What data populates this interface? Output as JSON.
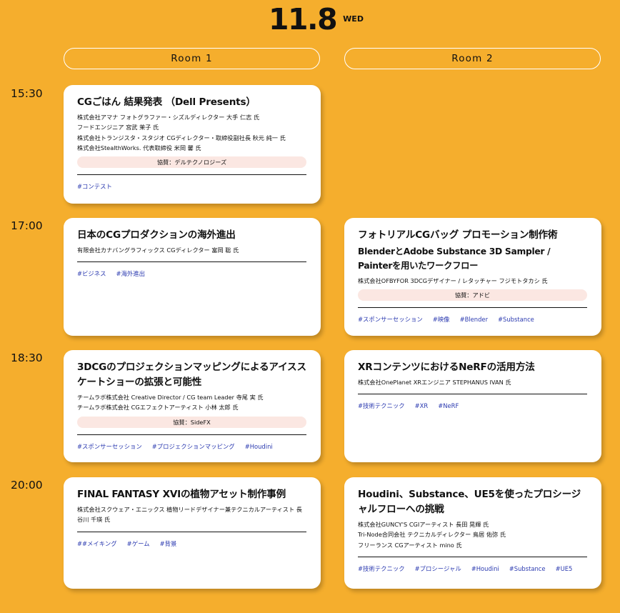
{
  "date": {
    "day": "11.8",
    "weekday": "WED"
  },
  "rooms": [
    "Room 1",
    "Room 2"
  ],
  "times": [
    "15:30",
    "17:00",
    "18:30",
    "20:00"
  ],
  "sessions": {
    "r1_1530": {
      "title": "CGごはん 結果発表 （Dell Presents）",
      "speakers": [
        "株式会社アマナ フォトグラファー・シズルディレクター 大手 仁志 氏",
        "フードエンジニア 宮武 茉子 氏",
        "株式会社トランジスタ・スタジオ CGディレクター・取締役副社長 秋元 純一 氏",
        "株式会社StealthWorks. 代表取締役 米岡 馨 氏"
      ],
      "sponsor": "協賛：デルテクノロジーズ",
      "tags": [
        "#コンテスト"
      ]
    },
    "r1_1700": {
      "title": "日本のCGプロダクションの海外進出",
      "speakers": [
        "有限会社カナバングラフィックス CGディレクター 富岡 聡 氏"
      ],
      "tags": [
        "#ビジネス",
        "#海外進出"
      ]
    },
    "r2_1700": {
      "title": "フォトリアルCGバッグ プロモーション制作術",
      "subtitle": "BlenderとAdobe Substance 3D Sampler / Painterを用いたワークフロー",
      "speakers": [
        "株式会社OFBYFOR 3DCGデザイナー / レタッチャー フジモトタカシ 氏"
      ],
      "sponsor": "協賛：アドビ",
      "tags": [
        "#スポンサーセッション",
        "#映像",
        "#Blender",
        "#Substance"
      ]
    },
    "r1_1830": {
      "title": "3DCGのプロジェクションマッピングによるアイススケートショーの拡張と可能性",
      "speakers": [
        "チームラボ株式会社 Creative Director / CG team Leader 寺尾 実 氏",
        "チームラボ株式会社 CGエフェクトアーティスト 小林 太郎 氏"
      ],
      "sponsor": "協賛：SideFX",
      "tags": [
        "#スポンサーセッション",
        "#プロジェクションマッピング",
        "#Houdini"
      ]
    },
    "r2_1830": {
      "title": "XRコンテンツにおけるNeRFの活用方法",
      "speakers": [
        "株式会社OnePlanet XRエンジニア STEPHANUS IVAN 氏"
      ],
      "tags": [
        "#技術テクニック",
        "#XR",
        "#NeRF"
      ]
    },
    "r1_2000": {
      "title": "FINAL FANTASY XVIの植物アセット制作事例",
      "speakers": [
        "株式会社スクウェア・エニックス 植物リードデザイナー兼テクニカルアーティスト 長谷川 千瑛 氏"
      ],
      "tags": [
        "##メイキング",
        "#ゲーム",
        "#背景"
      ]
    },
    "r2_2000": {
      "title": "Houdini、Substance、UE5を使ったプロシージャルフローへの挑戦",
      "speakers": [
        "株式会社GUNCY'S CGIアーティスト 長田 晃輝 氏",
        "Tri-Node合同会社 テクニカルディレクター 鳥居 佑弥 氏",
        "フリーランス CGアーティスト mino 氏"
      ],
      "tags": [
        "#技術テクニック",
        "#プロシージャル",
        "#Houdini",
        "#Substance",
        "#UE5"
      ]
    }
  },
  "colors": {
    "background": "#f5ae2d",
    "card": "#ffffff",
    "sponsor_bg": "#fbe7e2",
    "tag": "#2b3ab0"
  }
}
